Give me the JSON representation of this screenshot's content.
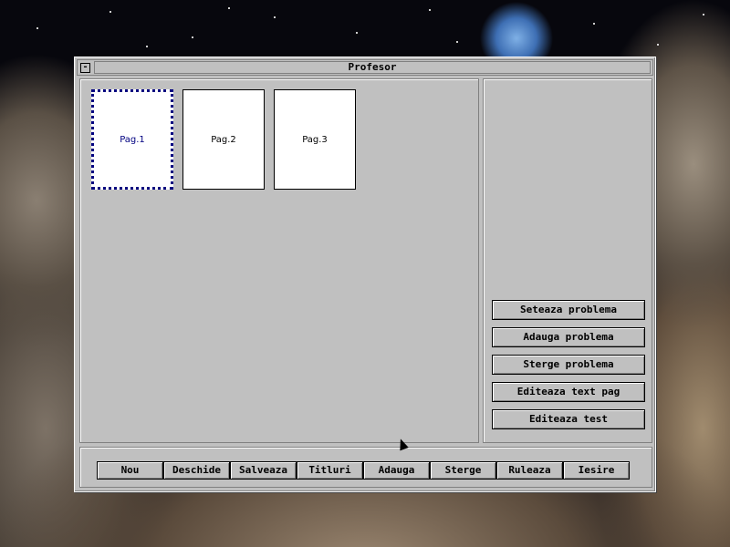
{
  "window": {
    "title": "Profesor",
    "sysmenu_glyph": "-"
  },
  "pages": [
    {
      "label": "Pag.1",
      "selected": true
    },
    {
      "label": "Pag.2",
      "selected": false
    },
    {
      "label": "Pag.3",
      "selected": false
    }
  ],
  "side_buttons": {
    "set_problem": "Seteaza problema",
    "add_problem": "Adauga problema",
    "delete_problem": "Sterge problema",
    "edit_page_text": "Editeaza text pag",
    "edit_test": "Editeaza test"
  },
  "bottom_buttons": {
    "new": "Nou",
    "open": "Deschide",
    "save": "Salveaza",
    "titles": "Titluri",
    "add": "Adauga",
    "delete": "Sterge",
    "run": "Ruleaza",
    "exit": "Iesire"
  },
  "colors": {
    "selected_page_border": "#000080",
    "window_bg": "#c0c0c0"
  }
}
